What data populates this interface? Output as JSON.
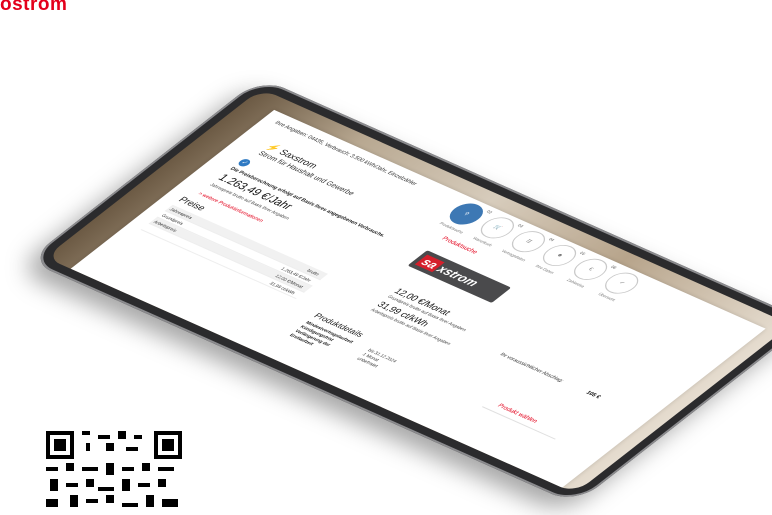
{
  "top_brand": "ostrom",
  "header": {
    "input_note": "Ihre Angaben: 04435, Verbrauch: 3.500 kWh/Jahr, Einzelzähler",
    "product_search": "Produktsuche"
  },
  "steps": [
    {
      "num": "",
      "label": "Produktsuche"
    },
    {
      "num": "02",
      "label": "Warenkorb"
    },
    {
      "num": "03",
      "label": "Vertragsdaten"
    },
    {
      "num": "04",
      "label": "Ihre Daten"
    },
    {
      "num": "05",
      "label": "Zahlweise"
    },
    {
      "num": "06",
      "label": "Übersicht"
    }
  ],
  "tariff": {
    "brand": "⚡ Saxstrom",
    "subtitle": "Strom für Haushalt und Gewerbe",
    "calc_note": "Die Preisberechnung erfolgt auf Basis Ihres angegebenen Verbrauchs.",
    "price_year": "1.263,49 €/Jahr",
    "price_year_note": "Jahrespreis brutto auf Basis Ihrer Angaben",
    "more_link": "> weitere Produktinformationen",
    "price_month": "12,00 €/Monat",
    "price_month_note": "Grundpreis brutto auf Basis Ihrer Angaben",
    "price_kwh": "31,99 ct/kWh",
    "price_kwh_note": "Arbeitspreis brutto auf Basis Ihrer Angaben",
    "deduction_label": "Ihr voraussichtlicher Abschlag:",
    "deduction_value": "105 €"
  },
  "logo": {
    "box": "sa",
    "rest": "xstrom"
  },
  "prices": {
    "title": "Preise",
    "rows": [
      {
        "label": "Jahrespreis",
        "value": "brutto"
      },
      {
        "label": "Grundpreis",
        "value": "1.263,49 €/Jahr"
      },
      {
        "label": "Arbeitspreis",
        "value": "12,00 €/Monat"
      },
      {
        "label": "",
        "value": "31,99 ct/kWh"
      }
    ]
  },
  "details": {
    "title": "Produktdetails",
    "labels": [
      "Mindestvertragslaufzeit",
      "Kündigungsfrist",
      "Verlängerung der",
      "Erstlaufzeit"
    ],
    "values": [
      "bis 31.12.2024",
      "1 Monat",
      "unbefristet"
    ],
    "choose": "Produkt wählen"
  },
  "colors": {
    "accent_red": "#e3001b",
    "step_active": "#3d78b4",
    "bezel": "#2b2b2d"
  }
}
